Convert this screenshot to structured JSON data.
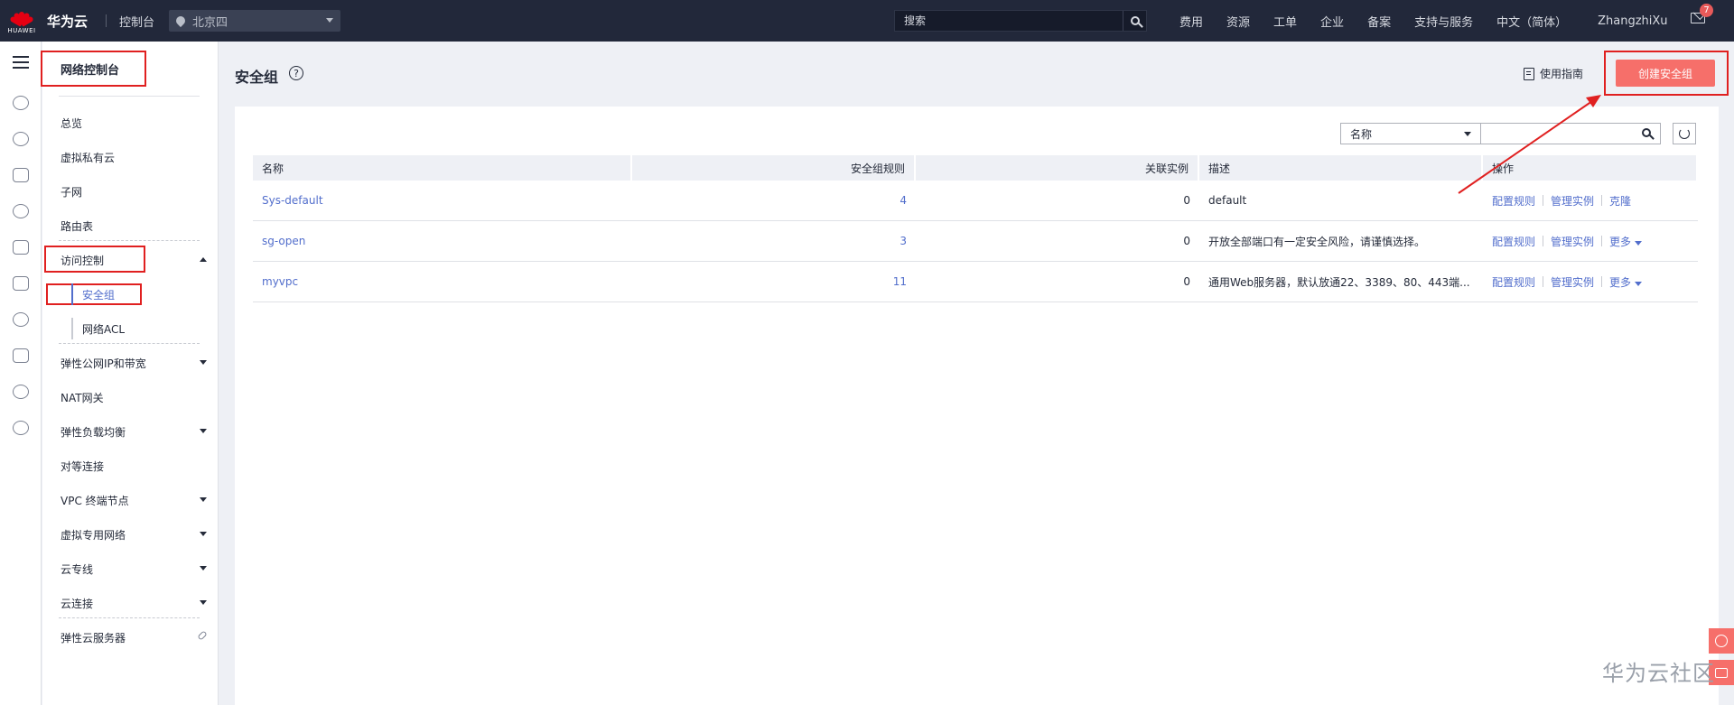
{
  "topbar": {
    "logo_text": "HUAWEI",
    "brand": "华为云",
    "console": "控制台",
    "region": "北京四",
    "search_placeholder": "搜索",
    "nav": [
      "费用",
      "资源",
      "工单",
      "企业",
      "备案",
      "支持与服务",
      "中文（简体）"
    ],
    "user": "ZhangzhiXu",
    "notification_count": "7"
  },
  "sidebar": {
    "title": "网络控制台",
    "items": {
      "overview": "总览",
      "vpc": "虚拟私有云",
      "subnet": "子网",
      "route_table": "路由表",
      "access_control": "访问控制",
      "security_group": "安全组",
      "network_acl": "网络ACL",
      "eip": "弹性公网IP和带宽",
      "nat": "NAT网关",
      "elb": "弹性负载均衡",
      "peering": "对等连接",
      "vpcep": "VPC 终端节点",
      "vpn": "虚拟专用网络",
      "direct_connect": "云专线",
      "cloud_connect": "云连接",
      "ecs": "弹性云服务器"
    }
  },
  "main": {
    "title": "安全组",
    "guide": "使用指南",
    "create_button": "创建安全组",
    "filter": {
      "field": "名称",
      "value": ""
    },
    "columns": [
      "名称",
      "安全组规则",
      "关联实例",
      "描述",
      "操作"
    ],
    "rows": [
      {
        "name": "Sys-default",
        "rules": "4",
        "instances": "0",
        "desc": "default",
        "op1": "配置规则",
        "op2": "管理实例",
        "op3": "克隆"
      },
      {
        "name": "sg-open",
        "rules": "3",
        "instances": "0",
        "desc": "开放全部端口有一定安全风险，请谨慎选择。",
        "op1": "配置规则",
        "op2": "管理实例",
        "op3": "更多"
      },
      {
        "name": "myvpc",
        "rules": "11",
        "instances": "0",
        "desc": "通用Web服务器，默认放通22、3389、80、443端...",
        "op1": "配置规则",
        "op2": "管理实例",
        "op3": "更多"
      }
    ]
  },
  "watermark": "华为云社区",
  "colors": {
    "accent": "#526ecc",
    "primary_button": "#f66f6a",
    "annotation": "#e02020",
    "topbar": "#22283a"
  }
}
